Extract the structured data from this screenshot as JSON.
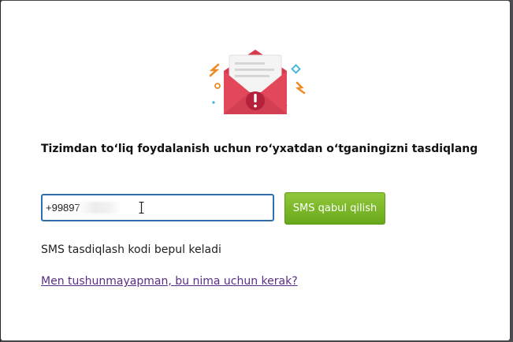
{
  "dialog": {
    "headline": "Tizimdan to‘liq foydalanish uchun ro‘yxatdan o‘tganingizni tasdiqlang",
    "phone_input": {
      "value": "+99897"
    },
    "sms_button_label": "SMS qabul qilish",
    "note": "SMS tasdiqlash kodi bepul keladi",
    "help_link": "Men tushunmayapman, bu nima uchun kerak?"
  },
  "icons": {
    "illustration": "envelope-alert-icon",
    "cursor": "text-cursor-icon"
  },
  "colors": {
    "envelope": "#e2475a",
    "button": "#7ab828",
    "input_border": "#2f6fae",
    "link": "#5b2d86"
  }
}
